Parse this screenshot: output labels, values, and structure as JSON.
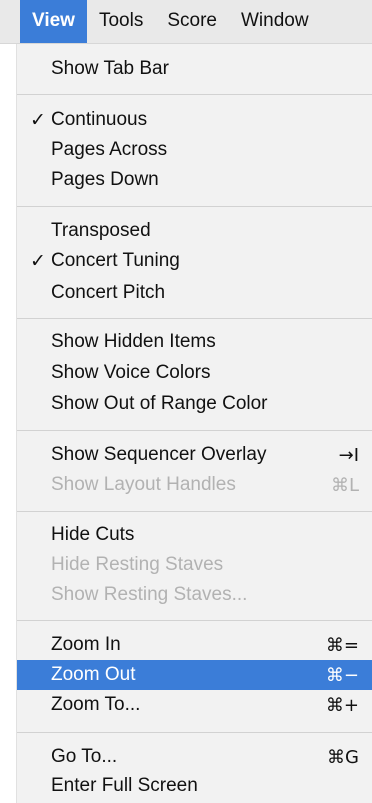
{
  "menubar": {
    "items": [
      "View",
      "Tools",
      "Score",
      "Window"
    ]
  },
  "menu": {
    "check_glyph": "✓",
    "items": [
      {
        "label": "Show Tab Bar"
      },
      {
        "label": "Continuous",
        "checked": true
      },
      {
        "label": "Pages Across"
      },
      {
        "label": "Pages Down"
      },
      {
        "label": "Transposed"
      },
      {
        "label": "Concert Tuning",
        "checked": true
      },
      {
        "label": "Concert Pitch"
      },
      {
        "label": "Show Hidden Items"
      },
      {
        "label": "Show Voice Colors"
      },
      {
        "label": "Show Out of Range Color"
      },
      {
        "label": "Show Sequencer Overlay",
        "shortcut": "→I"
      },
      {
        "label": "Show Layout Handles",
        "shortcut": "⌘L",
        "disabled": true
      },
      {
        "label": "Hide Cuts"
      },
      {
        "label": "Hide Resting Staves",
        "disabled": true
      },
      {
        "label": "Show Resting Staves...",
        "disabled": true
      },
      {
        "label": "Zoom In",
        "shortcut": "⌘="
      },
      {
        "label": "Zoom Out",
        "shortcut": "⌘−",
        "highlighted": true
      },
      {
        "label": "Zoom To...",
        "shortcut": "⌘+"
      },
      {
        "label": "Go To...",
        "shortcut": "⌘G"
      },
      {
        "label": "Enter Full Screen"
      }
    ]
  },
  "colors": {
    "highlight": "#3b7dd8",
    "disabled_text": "#b2b2b2",
    "menu_background": "#f2f2f2"
  }
}
